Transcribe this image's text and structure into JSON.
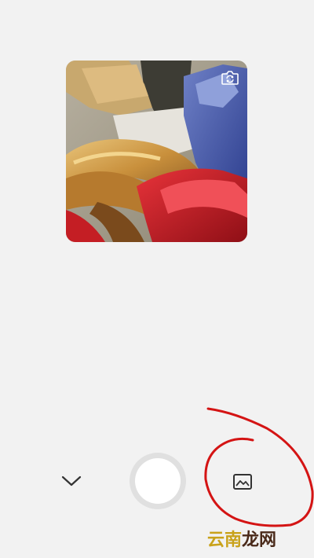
{
  "preview": {
    "description_icon": "camera-switch-icon"
  },
  "controls": {
    "collapse_icon": "chevron-down-icon",
    "shutter_icon": "shutter-button",
    "gallery_icon": "image-gallery-icon"
  },
  "watermark": {
    "part1": "云南",
    "part2": "龙网"
  },
  "colors": {
    "background": "#f2f2f2",
    "annotation": "#d41414",
    "shutter_ring": "#e0e0e0"
  }
}
